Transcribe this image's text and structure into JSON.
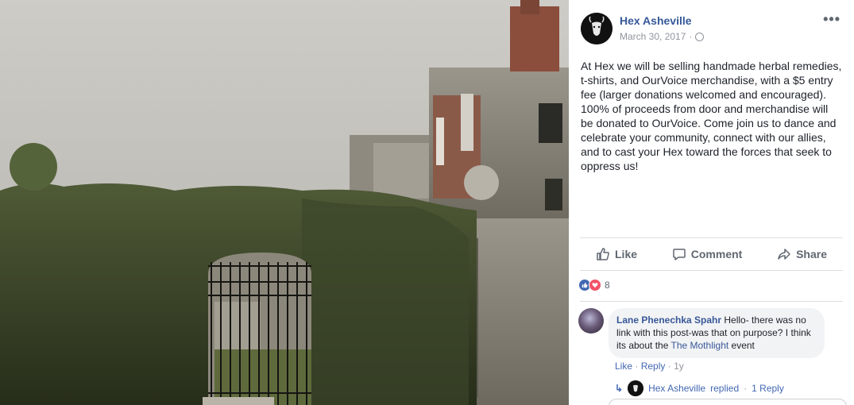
{
  "photo": {
    "description_icon": "ruined-building-photo"
  },
  "post": {
    "page_name": "Hex Asheville",
    "date": "March 30, 2017",
    "separator": "·",
    "text": "At Hex we will be selling handmade herbal remedies, t-shirts, and OurVoice merchandise, with a $5 entry fee (larger donations welcomed and encouraged). 100% of proceeds from door and merchandise will be donated to OurVoice. Come join us to dance and celebrate your community, connect with our allies, and to cast your Hex toward the forces that seek to oppress us!",
    "more_label": "•••"
  },
  "actions": {
    "like": "Like",
    "comment": "Comment",
    "share": "Share"
  },
  "reactions": {
    "count": "8"
  },
  "comment": {
    "author": "Lane Phenechka Spahr",
    "text_before": " Hello- there was no link with this post-was that on purpose? I think its about the ",
    "link_text": "The Mothlight",
    "text_after": " event",
    "like": "Like",
    "reply": "Reply",
    "dot": "·",
    "time": "1y"
  },
  "reply": {
    "arrow": "↳",
    "author": "Hex Asheville",
    "action": "replied",
    "dot": "·",
    "count_label": "1 Reply"
  },
  "colors": {
    "link": "#365899",
    "muted": "#90949c",
    "like_reaction": "#4267b2",
    "love_reaction": "#f25268"
  }
}
